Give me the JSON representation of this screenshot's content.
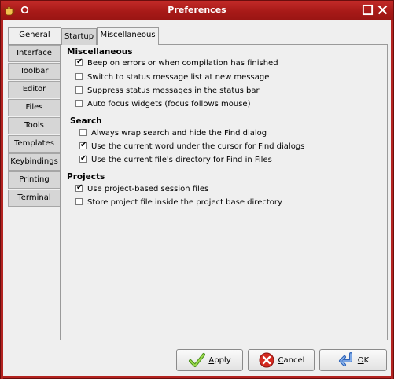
{
  "window": {
    "title": "Preferences"
  },
  "sidebar": {
    "tabs": [
      "General",
      "Interface",
      "Toolbar",
      "Editor",
      "Files",
      "Tools",
      "Templates",
      "Keybindings",
      "Printing",
      "Terminal"
    ],
    "active": "General"
  },
  "subtabs": {
    "startup": "Startup",
    "misc": "Miscellaneous",
    "active": "Miscellaneous"
  },
  "sections": {
    "misc": {
      "title": "Miscellaneous",
      "options": [
        {
          "label": "Beep on errors or when compilation has finished",
          "checked": true
        },
        {
          "label": "Switch to status message list at new message",
          "checked": false
        },
        {
          "label": "Suppress status messages in the status bar",
          "checked": false
        },
        {
          "label": "Auto focus widgets (focus follows mouse)",
          "checked": false
        }
      ]
    },
    "search": {
      "title": "Search",
      "options": [
        {
          "label": "Always wrap search and hide the Find dialog",
          "checked": false
        },
        {
          "label": "Use the current word under the cursor for Find dialogs",
          "checked": true
        },
        {
          "label": "Use the current file's directory for Find in Files",
          "checked": true
        }
      ]
    },
    "projects": {
      "title": "Projects",
      "options": [
        {
          "label": "Use project-based session files",
          "checked": true
        },
        {
          "label": "Store project file inside the project base directory",
          "checked": false
        }
      ]
    }
  },
  "buttons": {
    "apply": {
      "label": "Apply",
      "mnemonic": "A",
      "rest": "pply"
    },
    "cancel": {
      "label": "Cancel",
      "mnemonic": "C",
      "rest": "ancel"
    },
    "ok": {
      "label": "OK",
      "mnemonic": "O",
      "rest": "K"
    }
  }
}
